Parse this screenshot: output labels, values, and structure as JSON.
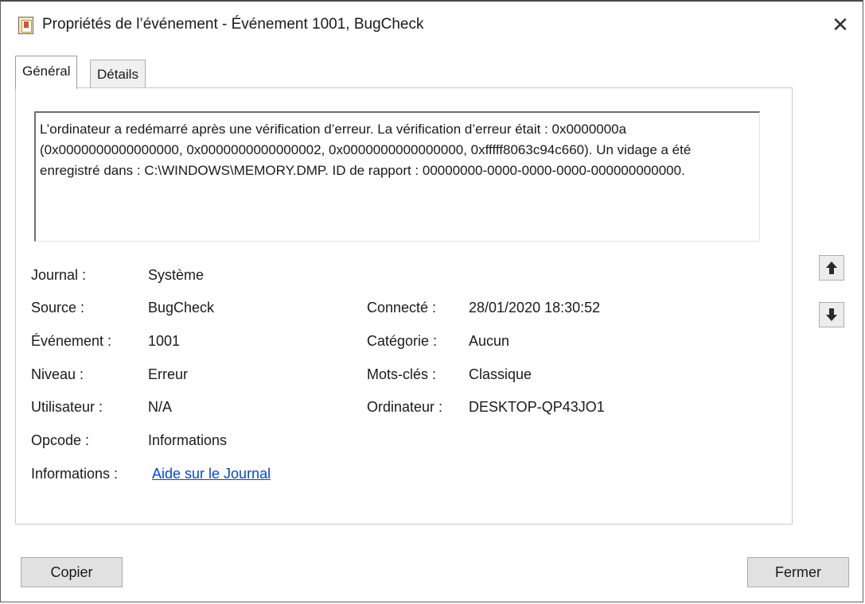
{
  "window": {
    "title": "Propriétés de l’événement - Événement 1001, BugCheck",
    "close_glyph": "✕",
    "icon": "event-viewer-icon"
  },
  "tabs": [
    {
      "label": "Général",
      "active": true
    },
    {
      "label": "Détails",
      "active": false
    }
  ],
  "description": "L’ordinateur a redémarré après une vérification d’erreur. La vérification d’erreur était : 0x0000000a (0x0000000000000000, 0x0000000000000002, 0x0000000000000000, 0xfffff8063c94c660). Un vidage a été enregistré dans : C:\\WINDOWS\\MEMORY.DMP. ID de rapport : 00000000-0000-0000-0000-000000000000.",
  "fields": {
    "journal": {
      "label": "Journal :",
      "value": "Système"
    },
    "source": {
      "label": "Source :",
      "value": "BugCheck"
    },
    "evenement": {
      "label": "Événement :",
      "value": "1001"
    },
    "niveau": {
      "label": "Niveau :",
      "value": "Erreur"
    },
    "utilisateur": {
      "label": "Utilisateur :",
      "value": "N/A"
    },
    "opcode": {
      "label": "Opcode :",
      "value": "Informations"
    },
    "informations": {
      "label": "Informations :",
      "value": "Aide sur le Journal"
    },
    "connecte": {
      "label": "Connecté :",
      "value": "28/01/2020 18:30:52"
    },
    "categorie": {
      "label": "Catégorie :",
      "value": "Aucun"
    },
    "mots_cles": {
      "label": "Mots-clés :",
      "value": "Classique"
    },
    "ordinateur": {
      "label": "Ordinateur :",
      "value": "DESKTOP-QP43JO1"
    }
  },
  "navigation": {
    "up_icon": "arrow-up-icon",
    "down_icon": "arrow-down-icon"
  },
  "buttons": {
    "copy": "Copier",
    "close": "Fermer"
  },
  "colors": {
    "link": "#0645d9",
    "button_bg": "#e1e1e1"
  }
}
